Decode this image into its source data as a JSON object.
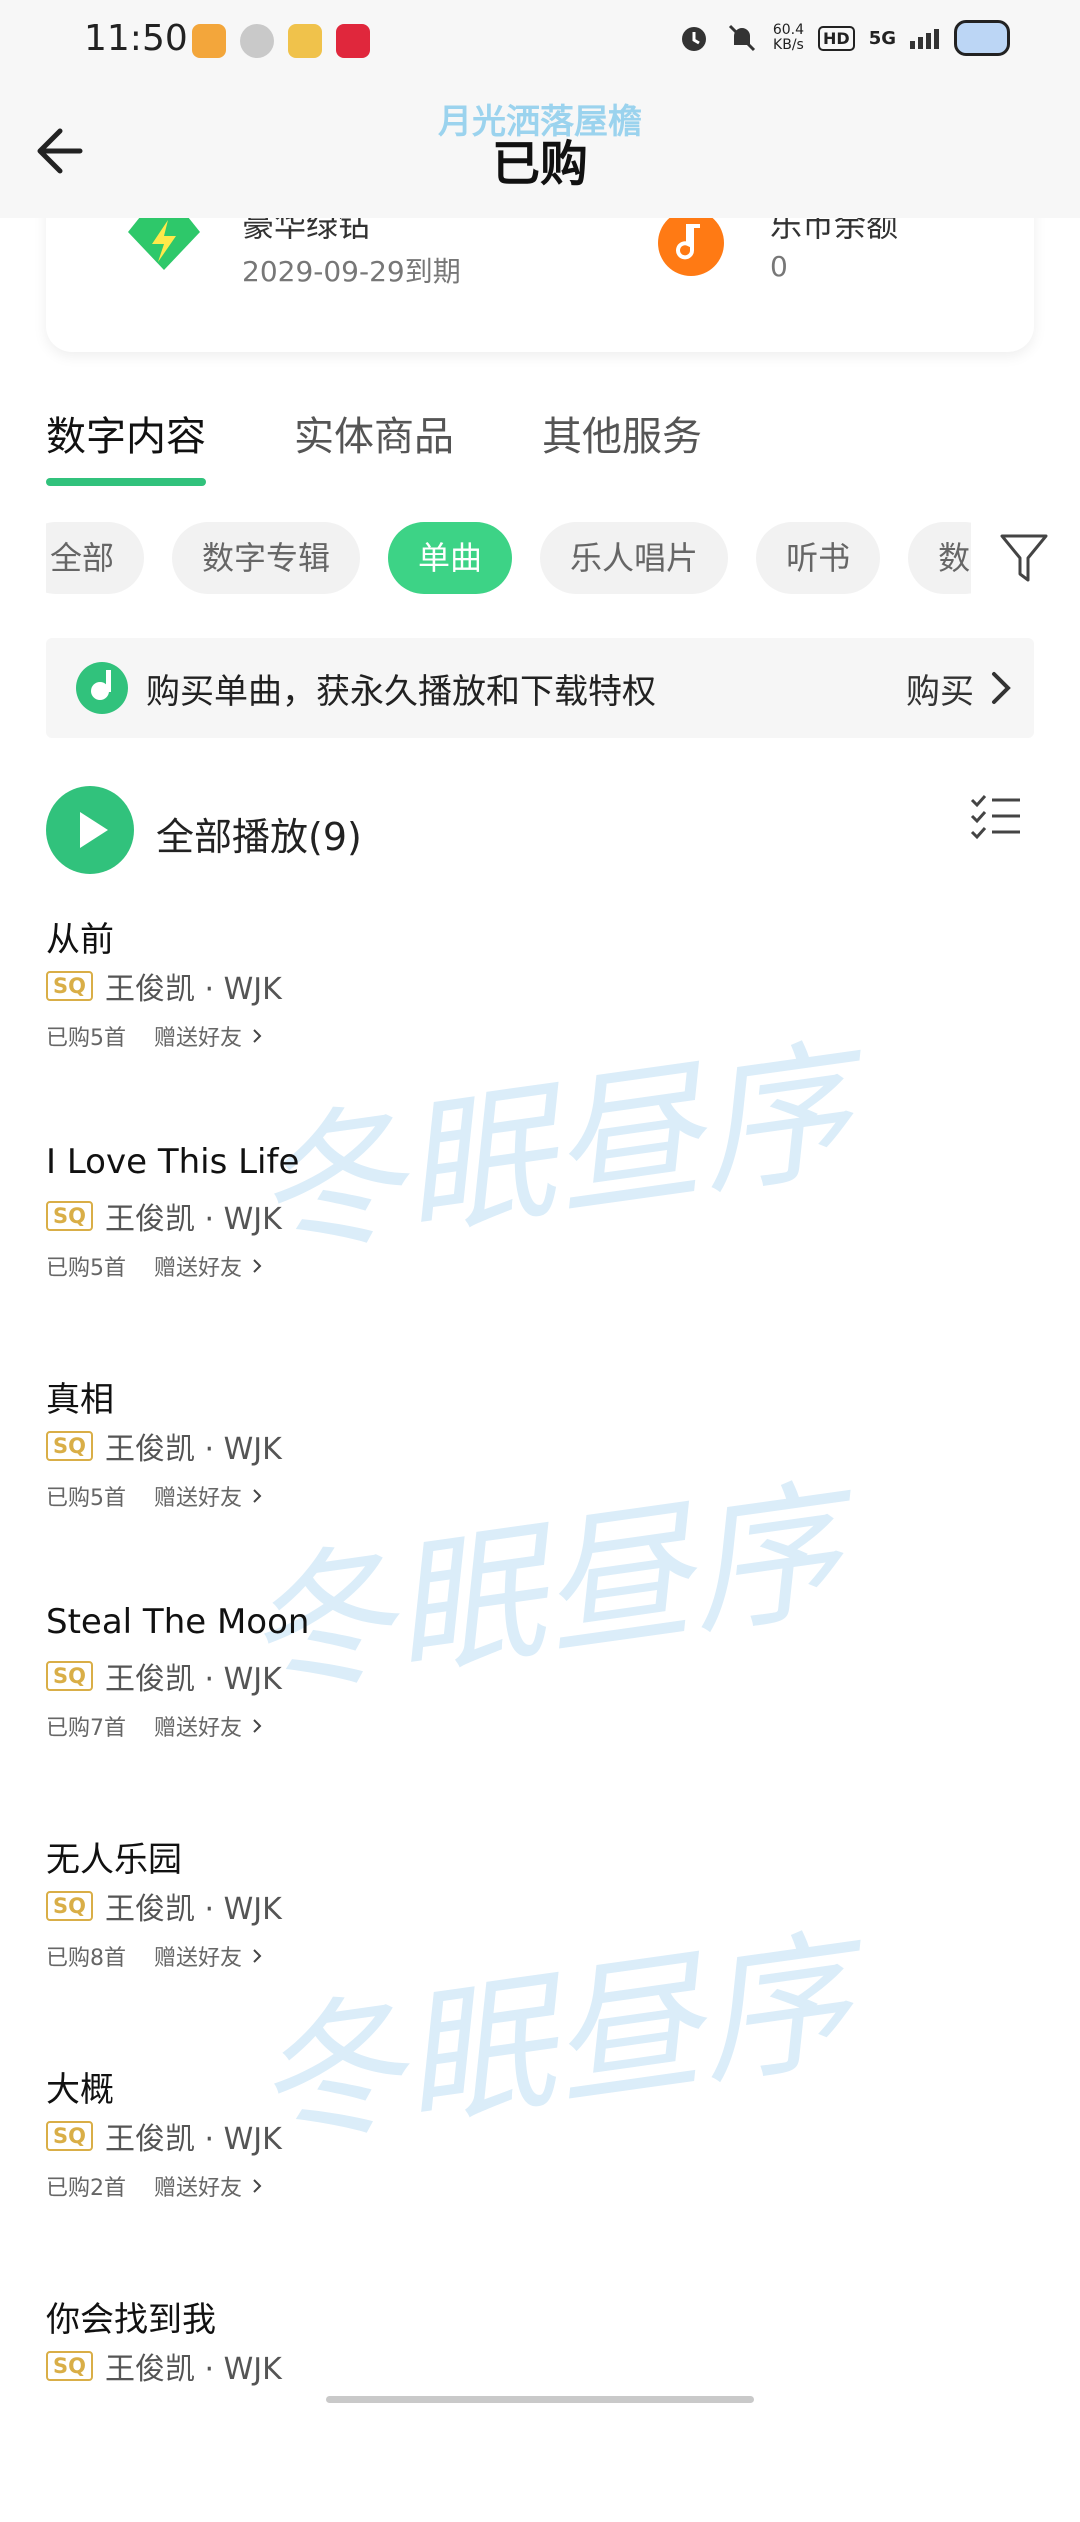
{
  "status_bar": {
    "time": "11:50",
    "net_speed": "60.4",
    "net_unit": "KB/s",
    "hd": "HD",
    "network": "5G"
  },
  "header": {
    "title": "已购",
    "overlay_watermark": "月光洒落屋檐"
  },
  "member_card": {
    "item1_title": "豪华绿钻",
    "item1_sub": "2029-09-29到期",
    "item2_title": "乐币余额",
    "item2_sub": "0"
  },
  "tabs": [
    {
      "label": "数字内容"
    },
    {
      "label": "实体商品"
    },
    {
      "label": "其他服务"
    }
  ],
  "chips": [
    {
      "label": "全部"
    },
    {
      "label": "数字专辑"
    },
    {
      "label": "单曲"
    },
    {
      "label": "乐人唱片"
    },
    {
      "label": "听书"
    },
    {
      "label": "数"
    }
  ],
  "banner": {
    "text": "购买单曲，获永久播放和下载特权",
    "action": "购买"
  },
  "play_all": {
    "label": "全部播放(9)"
  },
  "songs": [
    {
      "title": "从前",
      "quality": "SQ",
      "artist": "王俊凯 · WJK",
      "purchased": "已购5首",
      "gift": "赠送好友"
    },
    {
      "title": "I Love This Life",
      "quality": "SQ",
      "artist": "王俊凯 · WJK",
      "purchased": "已购5首",
      "gift": "赠送好友"
    },
    {
      "title": "真相",
      "quality": "SQ",
      "artist": "王俊凯 · WJK",
      "purchased": "已购5首",
      "gift": "赠送好友"
    },
    {
      "title": "Steal The Moon",
      "quality": "SQ",
      "artist": "王俊凯 · WJK",
      "purchased": "已购7首",
      "gift": "赠送好友"
    },
    {
      "title": "无人乐园",
      "quality": "SQ",
      "artist": "王俊凯 · WJK",
      "purchased": "已购8首",
      "gift": "赠送好友"
    },
    {
      "title": "大概",
      "quality": "SQ",
      "artist": "王俊凯 · WJK",
      "purchased": "已购2首",
      "gift": "赠送好友"
    },
    {
      "title": "你会找到我",
      "quality": "SQ",
      "artist": "王俊凯 · WJK",
      "purchased": "",
      "gift": ""
    }
  ],
  "watermark_text": "冬眠昼序",
  "colors": {
    "accent_green": "#31c27c",
    "chip_active": "#3dd386",
    "sq_gold": "#d9ae47"
  }
}
